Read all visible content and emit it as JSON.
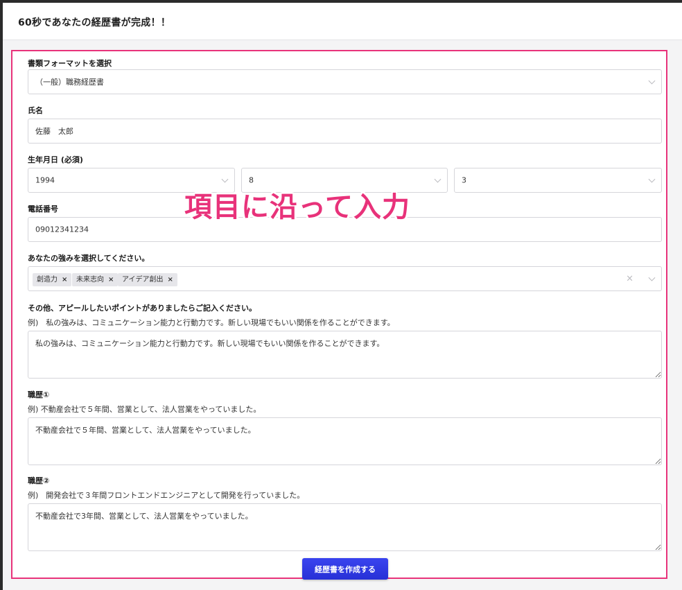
{
  "header": {
    "title": "60秒であなたの経歴書が完成！！"
  },
  "form": {
    "format": {
      "label": "書類フォーマットを選択",
      "value": "（一般）職務経歴書"
    },
    "name": {
      "label": "氏名",
      "value": "佐藤　太郎"
    },
    "birthdate": {
      "label": "生年月日 (必須)",
      "year": "1994",
      "month": "8",
      "day": "3"
    },
    "phone": {
      "label": "電話番号",
      "value": "09012341234"
    },
    "strengths": {
      "label": "あなたの強みを選択してください。",
      "tags": [
        "創造力",
        "未来志向",
        "アイデア創出"
      ],
      "remove_symbol": "×"
    },
    "appeal": {
      "label": "その他、アピールしたいポイントがありましたらご記入ください。",
      "example": "例)　私の強みは、コミュニケーション能力と行動力です。新しい現場でもいい関係を作ることができます。",
      "value": "私の強みは、コミュニケーション能力と行動力です。新しい現場でもいい関係を作ることができます。"
    },
    "career1": {
      "label": "職歴①",
      "example": "例) 不動産会社で５年間、営業として、法人営業をやっていました。",
      "value": "不動産会社で５年間、営業として、法人営業をやっていました。"
    },
    "career2": {
      "label": "職歴②",
      "example": "例)　開発会社で３年間フロントエンドエンジニアとして開発を行っていました。",
      "value": "不動産会社で3年間、営業として、法人営業をやっていました。"
    },
    "submit_label": "経歴書を作成する"
  },
  "annotation": {
    "text": "項目に沿って入力",
    "color": "#e8327a"
  },
  "colors": {
    "accent_border": "#e8327a",
    "button": "#2d36e0"
  }
}
